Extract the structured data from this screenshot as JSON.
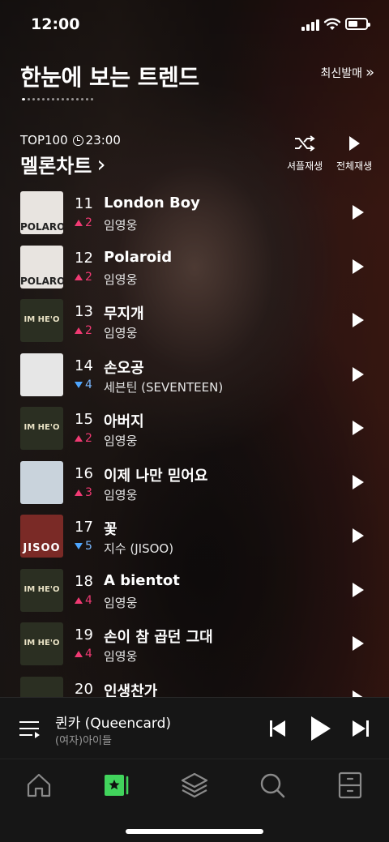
{
  "status_bar": {
    "time": "12:00"
  },
  "header": {
    "title": "한눈에 보는 트렌드",
    "new_release": "최신발매",
    "new_release_arrow": "»"
  },
  "chart": {
    "top_label": "TOP100",
    "updated_time": "23:00",
    "title": "멜론차트",
    "title_arrow": "›",
    "shuffle_label": "셔플재생",
    "play_all_label": "전체재생"
  },
  "songs": [
    {
      "rank": "11",
      "title": "London Boy",
      "artist": "임영웅",
      "dir": "up",
      "change": "2",
      "art_text": "POLAROID",
      "art_bg": "#e8e4e0",
      "art_fg": "#222222"
    },
    {
      "rank": "12",
      "title": "Polaroid",
      "artist": "임영웅",
      "dir": "up",
      "change": "2",
      "art_text": "POLAROID",
      "art_bg": "#e8e4e0",
      "art_fg": "#222222"
    },
    {
      "rank": "13",
      "title": "무지개",
      "artist": "임영웅",
      "dir": "up",
      "change": "2",
      "art_text": "IM HE'O",
      "art_bg": "#2b2f22",
      "art_fg": "#e9e2c5"
    },
    {
      "rank": "14",
      "title": "손오공",
      "artist": "세븐틴 (SEVENTEEN)",
      "dir": "down",
      "change": "4",
      "art_text": "",
      "art_bg": "#e6e6e6",
      "art_fg": "#999999"
    },
    {
      "rank": "15",
      "title": "아버지",
      "artist": "임영웅",
      "dir": "up",
      "change": "2",
      "art_text": "IM HE'O",
      "art_bg": "#2b2f22",
      "art_fg": "#e9e2c5"
    },
    {
      "rank": "16",
      "title": "이제 나만 믿어요",
      "artist": "임영웅",
      "dir": "up",
      "change": "3",
      "art_text": "",
      "art_bg": "#c9d3dc",
      "art_fg": "#222222"
    },
    {
      "rank": "17",
      "title": "꽃",
      "artist": "지수 (JISOO)",
      "dir": "down",
      "change": "5",
      "art_text": "JISOO",
      "art_bg": "#7a2a26",
      "art_fg": "#ffffff"
    },
    {
      "rank": "18",
      "title": "A bientot",
      "artist": "임영웅",
      "dir": "up",
      "change": "4",
      "art_text": "IM HE'O",
      "art_bg": "#2b2f22",
      "art_fg": "#e9e2c5"
    },
    {
      "rank": "19",
      "title": "손이 참 곱던 그대",
      "artist": "임영웅",
      "dir": "up",
      "change": "4",
      "art_text": "IM HE'O",
      "art_bg": "#2b2f22",
      "art_fg": "#e9e2c5"
    },
    {
      "rank": "20",
      "title": "인생찬가",
      "artist": "",
      "dir": "",
      "change": "",
      "art_text": "",
      "art_bg": "#2b2f22",
      "art_fg": "#e9e2c5"
    }
  ],
  "player": {
    "title": "퀸카 (Queencard)",
    "artist": "(여자)아이들"
  },
  "tabs": [
    {
      "name": "home"
    },
    {
      "name": "chart"
    },
    {
      "name": "library"
    },
    {
      "name": "search"
    },
    {
      "name": "storage"
    }
  ],
  "colors": {
    "accent_green": "#41d45c",
    "rank_up": "#f03a73",
    "rank_down": "#4ea6ff"
  }
}
